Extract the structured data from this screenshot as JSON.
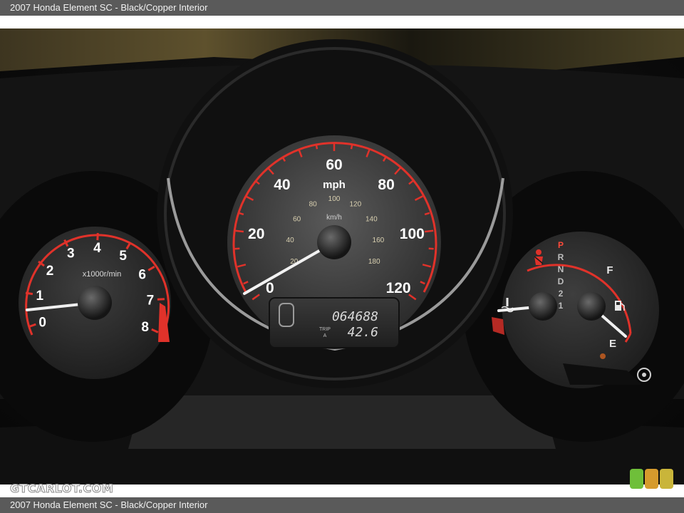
{
  "caption": {
    "top": "2007 Honda Element SC - Black/Copper Interior",
    "bottom": "2007 Honda Element SC - Black/Copper Interior"
  },
  "watermark": "GTCARLOT.COM",
  "swatch_colors": [
    "#6fbf3a",
    "#d69b2d",
    "#c9b53a"
  ],
  "tachometer": {
    "labels": [
      "0",
      "1",
      "2",
      "3",
      "4",
      "5",
      "6",
      "7",
      "8"
    ],
    "unit": "x1000r/min"
  },
  "speedometer": {
    "mph_labels": [
      "0",
      "20",
      "40",
      "60",
      "80",
      "100",
      "120"
    ],
    "mph_unit": "mph",
    "kmh_labels": [
      "20",
      "40",
      "60",
      "80",
      "100",
      "120",
      "140",
      "160",
      "180"
    ],
    "kmh_unit": "km/h"
  },
  "odometer": {
    "reading": "064688",
    "trip_label": "TRIP",
    "trip_sub": "A",
    "trip_reading": "42.6"
  },
  "gear_indicator": [
    "P",
    "R",
    "N",
    "D",
    "2",
    "1"
  ],
  "fuel_gauge": {
    "full": "F",
    "empty": "E"
  },
  "colors": {
    "accent_red": "#e0322a",
    "gear_p": "#ff4a3a"
  }
}
